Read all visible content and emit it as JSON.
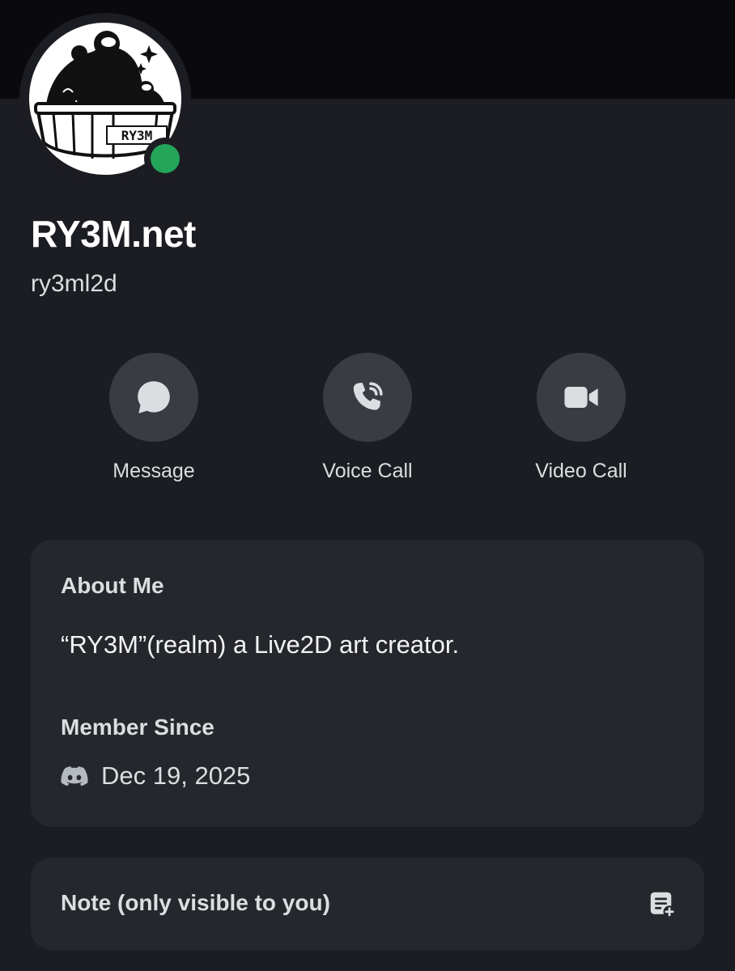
{
  "profile": {
    "display_name": "RY3M.net",
    "username": "ry3ml2d",
    "avatar_text": "RY3M",
    "status": "online"
  },
  "actions": [
    {
      "label": "Message",
      "icon": "chat-bubble-icon"
    },
    {
      "label": "Voice Call",
      "icon": "phone-icon"
    },
    {
      "label": "Video Call",
      "icon": "video-camera-icon"
    }
  ],
  "about": {
    "title": "About Me",
    "text": "“RY3M”(realm) a Live2D art creator.",
    "member_since_title": "Member Since",
    "member_since_date": "Dec 19, 2025",
    "member_since_icon": "discord-icon"
  },
  "note": {
    "label": "Note (only visible to you)",
    "icon": "add-note-icon"
  },
  "colors": {
    "background": "#1c1d22",
    "card": "#26272d",
    "action_circle": "#3a3c44",
    "status_online": "#23a55a",
    "banner": "#0a0a0c"
  }
}
